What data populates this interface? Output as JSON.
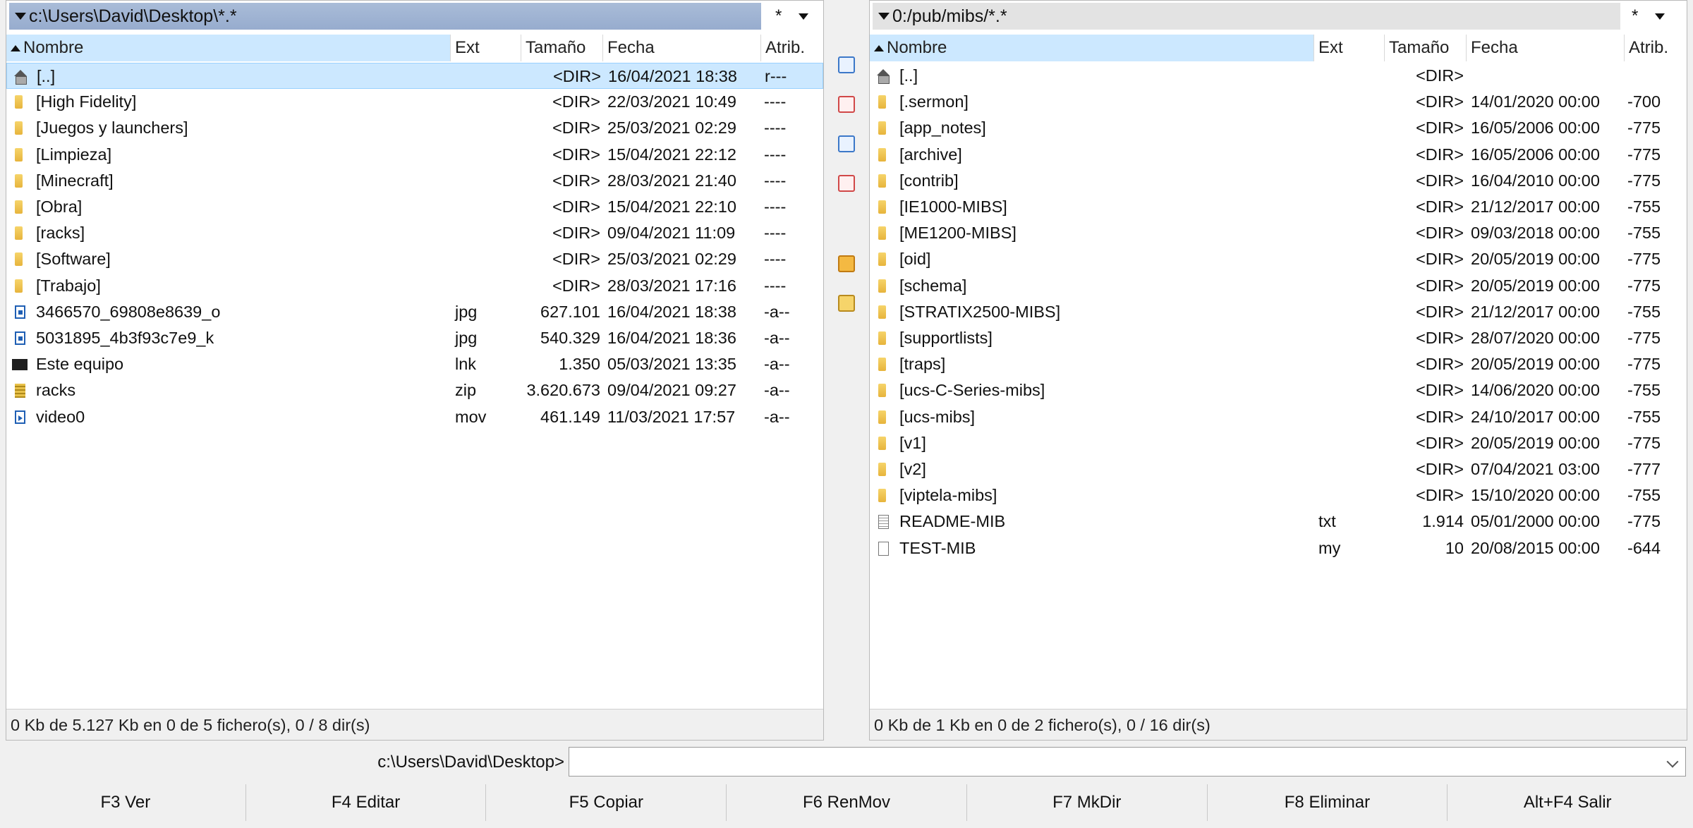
{
  "left": {
    "path": "c:\\Users\\David\\Desktop\\*.*",
    "filter": "*",
    "columns": {
      "name": "Nombre",
      "ext": "Ext",
      "size": "Tamaño",
      "date": "Fecha",
      "attr": "Atrib."
    },
    "rows": [
      {
        "icon": "up-dir-icon",
        "name": "[..]",
        "ext": "",
        "size": "<DIR>",
        "date": "16/04/2021 18:38",
        "attr": "r---",
        "selected": true
      },
      {
        "icon": "folder-icon",
        "name": "[High Fidelity]",
        "ext": "",
        "size": "<DIR>",
        "date": "22/03/2021 10:49",
        "attr": "----"
      },
      {
        "icon": "folder-icon",
        "name": "[Juegos y launchers]",
        "ext": "",
        "size": "<DIR>",
        "date": "25/03/2021 02:29",
        "attr": "----"
      },
      {
        "icon": "folder-icon",
        "name": "[Limpieza]",
        "ext": "",
        "size": "<DIR>",
        "date": "15/04/2021 22:12",
        "attr": "----"
      },
      {
        "icon": "folder-icon",
        "name": "[Minecraft]",
        "ext": "",
        "size": "<DIR>",
        "date": "28/03/2021 21:40",
        "attr": "----"
      },
      {
        "icon": "folder-icon",
        "name": "[Obra]",
        "ext": "",
        "size": "<DIR>",
        "date": "15/04/2021 22:10",
        "attr": "----"
      },
      {
        "icon": "folder-icon",
        "name": "[racks]",
        "ext": "",
        "size": "<DIR>",
        "date": "09/04/2021 11:09",
        "attr": "----"
      },
      {
        "icon": "folder-icon",
        "name": "[Software]",
        "ext": "",
        "size": "<DIR>",
        "date": "25/03/2021 02:29",
        "attr": "----"
      },
      {
        "icon": "folder-icon",
        "name": "[Trabajo]",
        "ext": "",
        "size": "<DIR>",
        "date": "28/03/2021 17:16",
        "attr": "----"
      },
      {
        "icon": "image-file-icon",
        "name": "3466570_69808e8639_o",
        "ext": "jpg",
        "size": "627.101",
        "date": "16/04/2021 18:38",
        "attr": "-a--"
      },
      {
        "icon": "image-file-icon",
        "name": "5031895_4b3f93c7e9_k",
        "ext": "jpg",
        "size": "540.329",
        "date": "16/04/2021 18:36",
        "attr": "-a--"
      },
      {
        "icon": "computer-icon",
        "name": "Este equipo",
        "ext": "lnk",
        "size": "1.350",
        "date": "05/03/2021 13:35",
        "attr": "-a--"
      },
      {
        "icon": "zip-icon",
        "name": "racks",
        "ext": "zip",
        "size": "3.620.673",
        "date": "09/04/2021 09:27",
        "attr": "-a--"
      },
      {
        "icon": "video-file-icon",
        "name": "video0",
        "ext": "mov",
        "size": "461.149",
        "date": "11/03/2021 17:57",
        "attr": "-a--"
      }
    ],
    "status": "0 Kb de 5.127 Kb en 0 de 5 fichero(s), 0 / 8 dir(s)"
  },
  "right": {
    "path": "0:/pub/mibs/*.*",
    "filter": "*",
    "columns": {
      "name": "Nombre",
      "ext": "Ext",
      "size": "Tamaño",
      "date": "Fecha",
      "attr": "Atrib."
    },
    "rows": [
      {
        "icon": "up-dir-icon",
        "name": "[..]",
        "ext": "",
        "size": "<DIR>",
        "date": "",
        "attr": ""
      },
      {
        "icon": "folder-icon",
        "name": "[.sermon]",
        "ext": "",
        "size": "<DIR>",
        "date": "14/01/2020 00:00",
        "attr": "-700"
      },
      {
        "icon": "folder-icon",
        "name": "[app_notes]",
        "ext": "",
        "size": "<DIR>",
        "date": "16/05/2006 00:00",
        "attr": "-775"
      },
      {
        "icon": "folder-icon",
        "name": "[archive]",
        "ext": "",
        "size": "<DIR>",
        "date": "16/05/2006 00:00",
        "attr": "-775"
      },
      {
        "icon": "folder-icon",
        "name": "[contrib]",
        "ext": "",
        "size": "<DIR>",
        "date": "16/04/2010 00:00",
        "attr": "-775"
      },
      {
        "icon": "folder-icon",
        "name": "[IE1000-MIBS]",
        "ext": "",
        "size": "<DIR>",
        "date": "21/12/2017 00:00",
        "attr": "-755"
      },
      {
        "icon": "folder-icon",
        "name": "[ME1200-MIBS]",
        "ext": "",
        "size": "<DIR>",
        "date": "09/03/2018 00:00",
        "attr": "-755"
      },
      {
        "icon": "folder-icon",
        "name": "[oid]",
        "ext": "",
        "size": "<DIR>",
        "date": "20/05/2019 00:00",
        "attr": "-775"
      },
      {
        "icon": "folder-icon",
        "name": "[schema]",
        "ext": "",
        "size": "<DIR>",
        "date": "20/05/2019 00:00",
        "attr": "-775"
      },
      {
        "icon": "folder-icon",
        "name": "[STRATIX2500-MIBS]",
        "ext": "",
        "size": "<DIR>",
        "date": "21/12/2017 00:00",
        "attr": "-755"
      },
      {
        "icon": "folder-icon",
        "name": "[supportlists]",
        "ext": "",
        "size": "<DIR>",
        "date": "28/07/2020 00:00",
        "attr": "-775"
      },
      {
        "icon": "folder-icon",
        "name": "[traps]",
        "ext": "",
        "size": "<DIR>",
        "date": "20/05/2019 00:00",
        "attr": "-775"
      },
      {
        "icon": "folder-icon",
        "name": "[ucs-C-Series-mibs]",
        "ext": "",
        "size": "<DIR>",
        "date": "14/06/2020 00:00",
        "attr": "-755"
      },
      {
        "icon": "folder-icon",
        "name": "[ucs-mibs]",
        "ext": "",
        "size": "<DIR>",
        "date": "24/10/2017 00:00",
        "attr": "-755"
      },
      {
        "icon": "folder-icon",
        "name": "[v1]",
        "ext": "",
        "size": "<DIR>",
        "date": "20/05/2019 00:00",
        "attr": "-775"
      },
      {
        "icon": "folder-icon",
        "name": "[v2]",
        "ext": "",
        "size": "<DIR>",
        "date": "07/04/2021 03:00",
        "attr": "-777"
      },
      {
        "icon": "folder-icon",
        "name": "[viptela-mibs]",
        "ext": "",
        "size": "<DIR>",
        "date": "15/10/2020 00:00",
        "attr": "-755"
      },
      {
        "icon": "text-file-icon",
        "name": "README-MIB",
        "ext": "txt",
        "size": "1.914",
        "date": "05/01/2000 00:00",
        "attr": "-775"
      },
      {
        "icon": "file-icon",
        "name": "TEST-MIB",
        "ext": "my",
        "size": "10",
        "date": "20/08/2015 00:00",
        "attr": "-644"
      }
    ],
    "status": "0 Kb de 1 Kb en 0 de 2 fichero(s), 0 / 16 dir(s)"
  },
  "toolbar": [
    {
      "icon": "view-file-icon"
    },
    {
      "icon": "edit-file-icon"
    },
    {
      "icon": "copy-files-icon"
    },
    {
      "icon": "move-files-icon"
    },
    {
      "icon": "pack-icon"
    },
    {
      "icon": "new-folder-icon"
    }
  ],
  "command": {
    "label": "c:\\Users\\David\\Desktop>",
    "value": ""
  },
  "fkeys": [
    "F3 Ver",
    "F4 Editar",
    "F5 Copiar",
    "F6 RenMov",
    "F7 MkDir",
    "F8 Eliminar",
    "Alt+F4 Salir"
  ],
  "colors": {
    "path_active": "#a9bcd8",
    "selection": "#cce8ff",
    "folder": "#f2c94c"
  }
}
